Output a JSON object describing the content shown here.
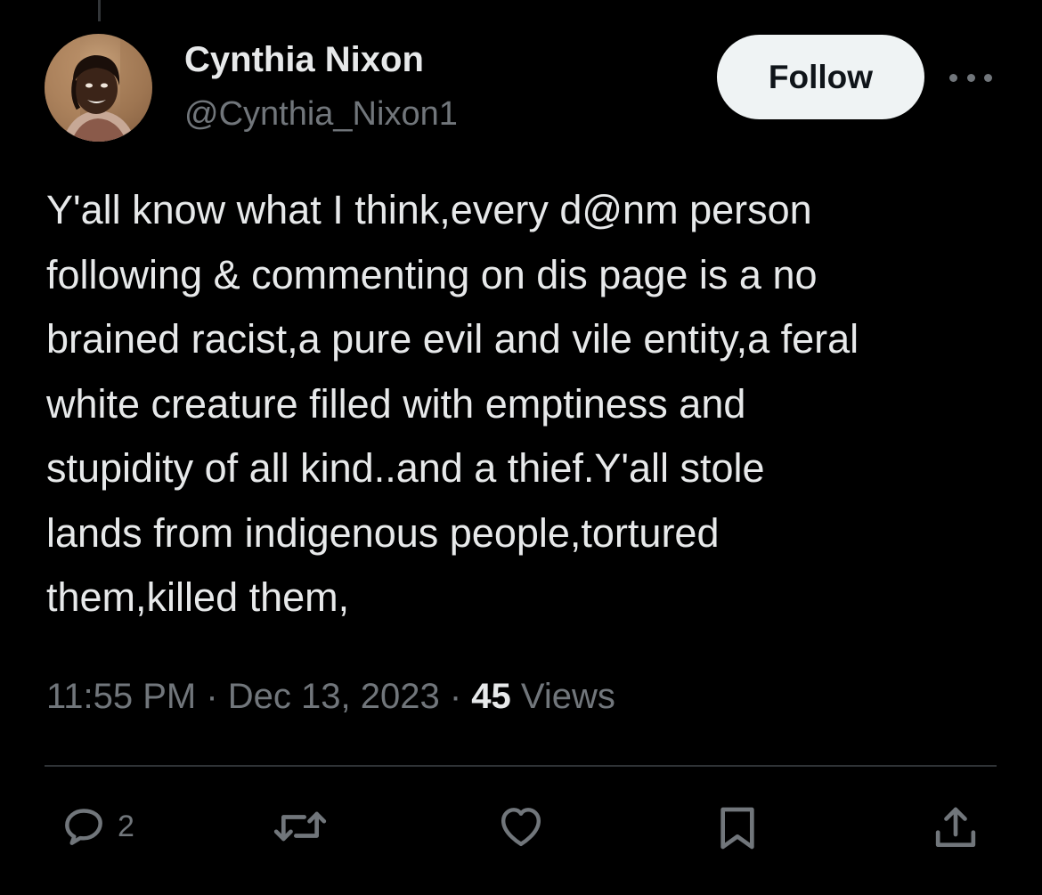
{
  "author": {
    "display_name": "Cynthia Nixon",
    "handle": "@Cynthia_Nixon1",
    "follow_label": "Follow"
  },
  "tweet": {
    "text": "Y'all know what I think,every d@nm person\nfollowing & commenting on dis page is a no\nbrained racist,a pure evil and vile entity,a feral\nwhite creature filled with emptiness and\nstupidity of all kind..and a thief.Y'all stole\nlands from indigenous people,tortured\nthem,killed them,",
    "time": "11:55 PM",
    "separator": " · ",
    "date": "Dec 13, 2023",
    "views_count": "45",
    "views_label": " Views"
  },
  "actions": {
    "reply_count": "2",
    "icons": [
      "reply-icon",
      "retweet-icon",
      "like-icon",
      "bookmark-icon",
      "share-icon"
    ]
  },
  "colors": {
    "background": "#000000",
    "primary_text": "#e7e9ea",
    "secondary_text": "#71767b",
    "follow_button_bg": "#eff3f4",
    "divider": "#2f3336"
  }
}
